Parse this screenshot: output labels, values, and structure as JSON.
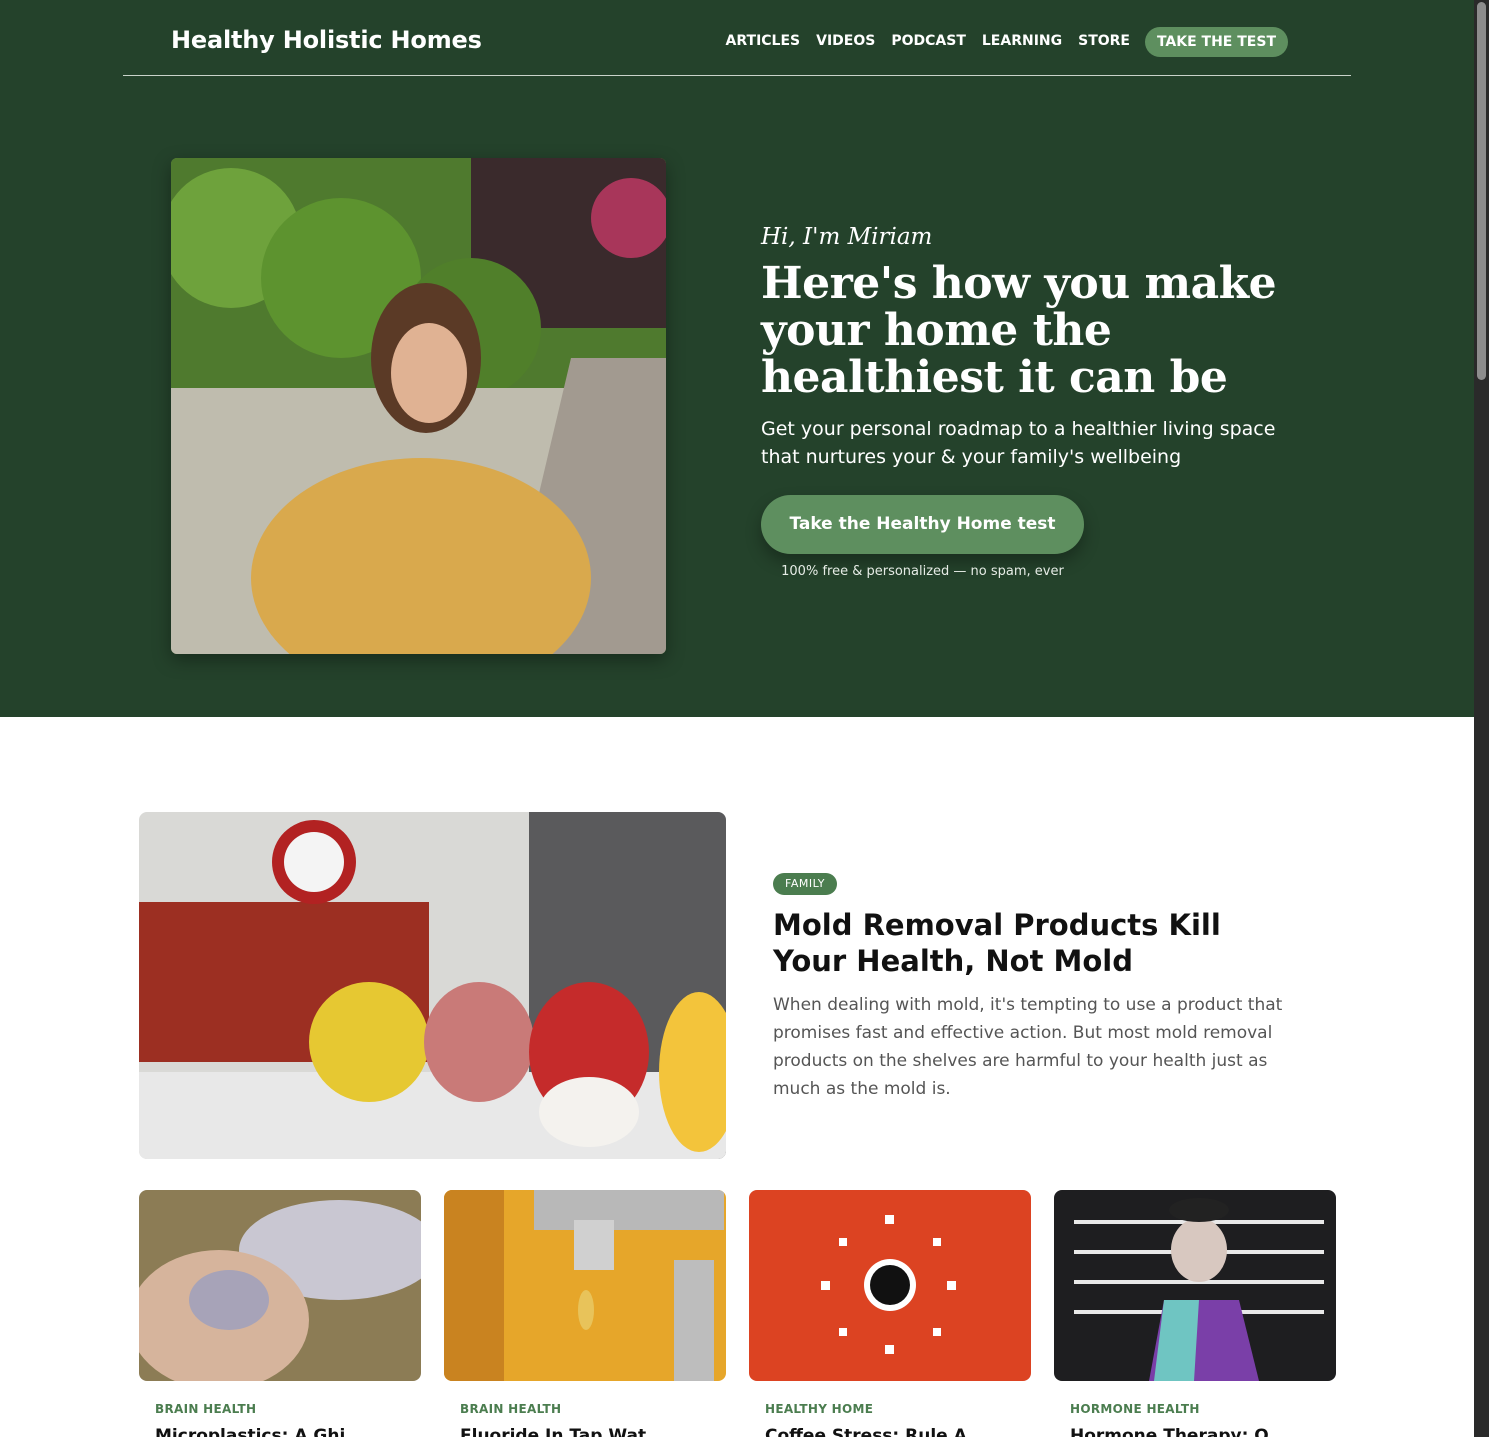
{
  "site": {
    "logo": "Healthy Holistic Homes"
  },
  "nav": {
    "links": [
      "ARTICLES",
      "VIDEOS",
      "PODCAST",
      "LEARNING",
      "STORE"
    ],
    "cta": "TAKE THE TEST"
  },
  "hero": {
    "greeting": "Hi, I'm Miriam",
    "headline": "Here's how you make your home the healthiest it can be",
    "subhead": "Get your personal roadmap to a healthier living space that nurtures your & your family's wellbeing",
    "button": "Take the Healthy Home test",
    "note": "100% free & personalized — no spam, ever"
  },
  "featured": {
    "category": "FAMILY",
    "title": "Mold Removal Products Kill Your Health, Not Mold",
    "excerpt": "When dealing with mold, it's tempting to use a product that promises fast and effective action. But most mold removal products on the shelves are harmful to your health just as much as the mold is."
  },
  "cards": [
    {
      "category": "BRAIN HEALTH",
      "title": "Microplastics: A Ghi..."
    },
    {
      "category": "BRAIN HEALTH",
      "title": "Fluoride In Tap Wat..."
    },
    {
      "category": "HEALTHY HOME",
      "title": "Coffee Stress: Rule A..."
    },
    {
      "category": "HORMONE HEALTH",
      "title": "Hormone Therapy: O..."
    }
  ]
}
